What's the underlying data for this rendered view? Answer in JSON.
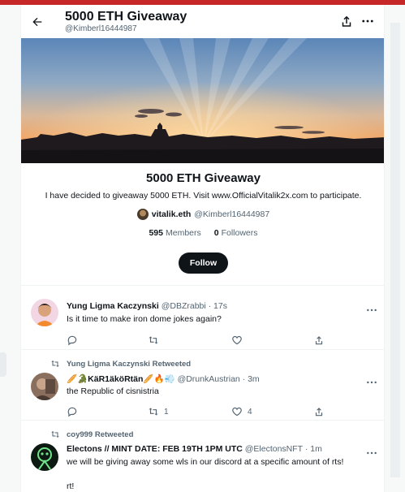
{
  "header": {
    "title": "5000 ETH Giveaway",
    "handle": "@Kimberl16444987"
  },
  "list": {
    "name": "5000 ETH Giveaway",
    "description": "I have decided to giveaway 5000 ETH. Visit www.OfficialVitalik2x.com to participate.",
    "owner_name": "vitalik.eth",
    "owner_handle": "@Kimberl16444987",
    "members_count": "595",
    "members_label": "Members",
    "followers_count": "0",
    "followers_label": "Followers",
    "follow_label": "Follow"
  },
  "tweets": [
    {
      "retweeted_by": "",
      "name": "Yung Ligma Kaczynski",
      "handle_time": "@DBZrabbi · 17s",
      "text": "Is it time to make iron dome jokes again?",
      "text2": "",
      "reply_count": "",
      "retweet_count": "",
      "like_count": ""
    },
    {
      "retweeted_by": "Yung Ligma Kaczynski Retweeted",
      "name": "🥖🐊KäR1äköRtän🥖🔥💨",
      "handle_time": "@DrunkAustrian · 3m",
      "text": "the Republic of cisnistria",
      "text2": "",
      "reply_count": "",
      "retweet_count": "1",
      "like_count": "4"
    },
    {
      "retweeted_by": "coy999 Retweeted",
      "name": "Electons // MINT DATE: FEB 19TH 1PM UTC",
      "handle_time": "@ElectonsNFT · 1m",
      "text": "we will be giving away some wls in our discord at a specific amount of rts!",
      "text2": "rt!",
      "reply_count": "",
      "retweet_count": "",
      "like_count": ""
    }
  ],
  "colors": {
    "accent_dark": "#0f1419",
    "secondary_text": "#536471",
    "top_bar": "#c62828"
  }
}
